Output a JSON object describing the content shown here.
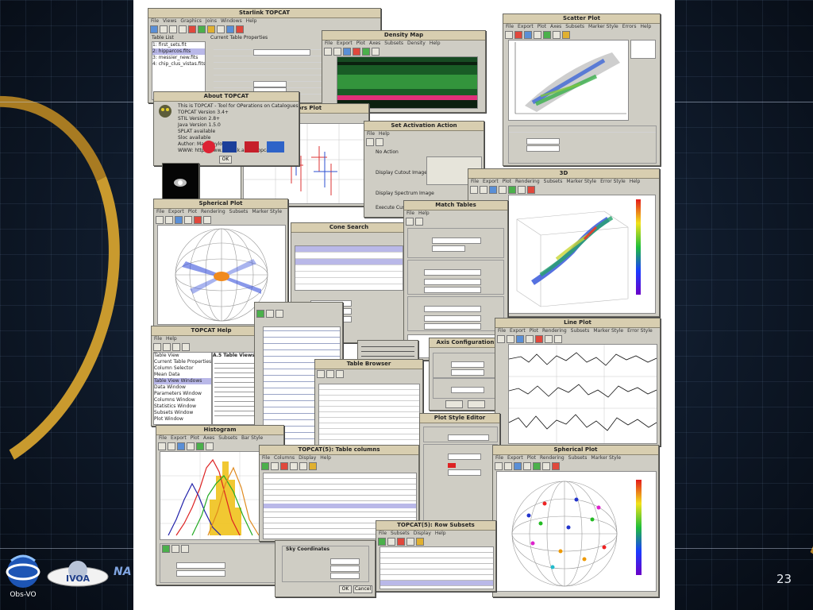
{
  "slide": {
    "page_number": "23",
    "footer_fragment": "e",
    "accent_gold": "#d9a734",
    "bg_dark": "#0e1826"
  },
  "logos": {
    "observatory": {
      "text": "Obs-VO",
      "icon": "vo-globe-icon"
    },
    "ivoa": {
      "text": "IVOA",
      "icon": "ivoa-saturn-icon"
    },
    "nasa": {
      "text": "NA",
      "icon": "nasa-logo-icon"
    }
  },
  "windows": {
    "main": {
      "title": "Starlink TOPCAT",
      "menu": [
        "File",
        "Views",
        "Graphics",
        "Joins",
        "Windows",
        "Help"
      ],
      "list_header": "Table List",
      "tables": [
        "1: first_sets.fit",
        "2: hipparcos.fits",
        "3: messier_new.fits",
        "4: chip_clus_vistas.fits"
      ],
      "props_header": "Current Table Properties"
    },
    "about": {
      "title": "About TOPCAT",
      "lines": [
        "This is TOPCAT - Tool for OPerations on Catalogues And Tables",
        "TOPCAT Version 3.4+",
        "STIL Version 2.8+",
        "Java Version 1.5.0",
        "SPLAT available",
        "Sloc available",
        "Author: Mark Taylor",
        "WWW: http://www.starlink.ac.uk/topcat/"
      ],
      "ok": "OK"
    },
    "density": {
      "title": "Density Map",
      "menu": [
        "File",
        "Export",
        "Plot",
        "Axes",
        "Subsets",
        "Density",
        "Help"
      ]
    },
    "scatter": {
      "title": "Scatter Plot",
      "menu": [
        "File",
        "Export",
        "Plot",
        "Axes",
        "Subsets",
        "Marker Style",
        "Errors",
        "Help"
      ]
    },
    "errors": {
      "title": "Errors Plot"
    },
    "activation": {
      "title": "Set Activation Action",
      "menu": [
        "File",
        "Help"
      ],
      "options": [
        "No Action",
        "Display Cutout Image",
        "Display Spectrum Image",
        "Execute Custom Code"
      ]
    },
    "plot3d": {
      "title": "3D",
      "menu": [
        "File",
        "Export",
        "Plot",
        "Rendering",
        "Subsets",
        "Marker Style",
        "Error Style",
        "Help"
      ]
    },
    "spherical_top": {
      "title": "Spherical Plot",
      "menu": [
        "File",
        "Export",
        "Plot",
        "Rendering",
        "Subsets",
        "Marker Style",
        "Error Style",
        "Help"
      ]
    },
    "cone": {
      "title": "Cone Search"
    },
    "match": {
      "title": "Match Tables",
      "menu": [
        "File",
        "Help"
      ]
    },
    "help": {
      "title": "TOPCAT Help",
      "menu": [
        "File",
        "Help"
      ],
      "heading": "A.5 Table Views",
      "tree": [
        "Table View",
        "Current Table Properties",
        "Column Selector",
        "Mean Data",
        "Table View Windows",
        "Data Window",
        "Parameters Window",
        "Columns Window",
        "Statistics Window",
        "Subsets Window",
        "Plot Window"
      ]
    },
    "line": {
      "title": "Line Plot",
      "menu": [
        "File",
        "Export",
        "Plot",
        "Rendering",
        "Subsets",
        "Marker Style",
        "Error Style",
        "Help"
      ]
    },
    "axis_config": {
      "title": "Axis Configuration"
    },
    "histogram": {
      "title": "Histogram",
      "menu": [
        "File",
        "Export",
        "Plot",
        "Axes",
        "Subsets",
        "Bar Style",
        "Help"
      ]
    },
    "columns": {
      "title": "TOPCAT(5): Table columns",
      "menu": [
        "File",
        "Columns",
        "Display",
        "Help"
      ]
    },
    "style": {
      "title": "Plot Style Editor"
    },
    "spherical_bottom": {
      "title": "Spherical Plot",
      "menu": [
        "File",
        "Export",
        "Plot",
        "Rendering",
        "Subsets",
        "Marker Style",
        "Error Style",
        "Help"
      ]
    },
    "subsets": {
      "title": "TOPCAT(5): Row Subsets",
      "menu": [
        "File",
        "Subsets",
        "Display",
        "Help"
      ]
    },
    "sky": {
      "title": "Sky Coordinates",
      "ok": "OK",
      "cancel": "Cancel"
    },
    "rows": {
      "title": "Table Browser"
    }
  }
}
